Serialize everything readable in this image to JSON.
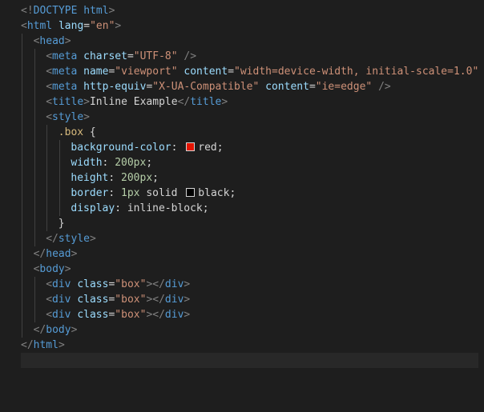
{
  "editor": {
    "lines": [
      {
        "tokens": [
          [
            "punct",
            "<!"
          ],
          [
            "tag",
            "DOCTYPE html"
          ],
          [
            "punct",
            ">"
          ]
        ]
      },
      {
        "tokens": [
          [
            "punct",
            "<"
          ],
          [
            "tag",
            "html"
          ],
          [
            "text",
            " "
          ],
          [
            "attr",
            "lang"
          ],
          [
            "text",
            "="
          ],
          [
            "str",
            "\"en\""
          ],
          [
            "punct",
            ">"
          ]
        ]
      },
      {
        "indent": 1,
        "tokens": [
          [
            "punct",
            "<"
          ],
          [
            "tag",
            "head"
          ],
          [
            "punct",
            ">"
          ]
        ]
      },
      {
        "indent": 2,
        "tokens": [
          [
            "punct",
            "<"
          ],
          [
            "tag",
            "meta"
          ],
          [
            "text",
            " "
          ],
          [
            "attr",
            "charset"
          ],
          [
            "text",
            "="
          ],
          [
            "str",
            "\"UTF-8\""
          ],
          [
            "text",
            " "
          ],
          [
            "punct",
            "/>"
          ]
        ]
      },
      {
        "indent": 2,
        "tokens": [
          [
            "punct",
            "<"
          ],
          [
            "tag",
            "meta"
          ],
          [
            "text",
            " "
          ],
          [
            "attr",
            "name"
          ],
          [
            "text",
            "="
          ],
          [
            "str",
            "\"viewport\""
          ],
          [
            "text",
            " "
          ],
          [
            "attr",
            "content"
          ],
          [
            "text",
            "="
          ],
          [
            "str",
            "\"width=device-width, initial-scale=1.0\""
          ],
          [
            "text",
            " "
          ]
        ],
        "overflow": true
      },
      {
        "indent": 2,
        "tokens": [
          [
            "punct",
            "<"
          ],
          [
            "tag",
            "meta"
          ],
          [
            "text",
            " "
          ],
          [
            "attr",
            "http-equiv"
          ],
          [
            "text",
            "="
          ],
          [
            "str",
            "\"X-UA-Compatible\""
          ],
          [
            "text",
            " "
          ],
          [
            "attr",
            "content"
          ],
          [
            "text",
            "="
          ],
          [
            "str",
            "\"ie=edge\""
          ],
          [
            "text",
            " "
          ],
          [
            "punct",
            "/>"
          ]
        ]
      },
      {
        "indent": 2,
        "tokens": [
          [
            "punct",
            "<"
          ],
          [
            "tag",
            "title"
          ],
          [
            "punct",
            ">"
          ],
          [
            "text",
            "Inline Example"
          ],
          [
            "punct",
            "</"
          ],
          [
            "tag",
            "title"
          ],
          [
            "punct",
            ">"
          ]
        ]
      },
      {
        "indent": 2,
        "tokens": [
          [
            "punct",
            "<"
          ],
          [
            "tag",
            "style"
          ],
          [
            "punct",
            ">"
          ]
        ]
      },
      {
        "indent": 3,
        "tokens": [
          [
            "sel",
            ".box"
          ],
          [
            "text",
            " {"
          ]
        ]
      },
      {
        "indent": 4,
        "tokens": [
          [
            "prop",
            "background-color"
          ],
          [
            "text",
            ": "
          ],
          [
            "swatch",
            "#e51400"
          ],
          [
            "val",
            "red"
          ],
          [
            "text",
            ";"
          ]
        ]
      },
      {
        "indent": 4,
        "tokens": [
          [
            "prop",
            "width"
          ],
          [
            "text",
            ": "
          ],
          [
            "num",
            "200px"
          ],
          [
            "text",
            ";"
          ]
        ]
      },
      {
        "indent": 4,
        "tokens": [
          [
            "prop",
            "height"
          ],
          [
            "text",
            ": "
          ],
          [
            "num",
            "200px"
          ],
          [
            "text",
            ";"
          ]
        ]
      },
      {
        "indent": 4,
        "tokens": [
          [
            "prop",
            "border"
          ],
          [
            "text",
            ": "
          ],
          [
            "num",
            "1px"
          ],
          [
            "val",
            " solid "
          ],
          [
            "swatch",
            "#000000"
          ],
          [
            "val",
            "black"
          ],
          [
            "text",
            ";"
          ]
        ]
      },
      {
        "indent": 4,
        "tokens": [
          [
            "prop",
            "display"
          ],
          [
            "text",
            ": "
          ],
          [
            "val",
            "inline-block"
          ],
          [
            "text",
            ";"
          ]
        ]
      },
      {
        "indent": 3,
        "tokens": [
          [
            "text",
            "}"
          ]
        ]
      },
      {
        "indent": 2,
        "tokens": [
          [
            "punct",
            "</"
          ],
          [
            "tag",
            "style"
          ],
          [
            "punct",
            ">"
          ]
        ]
      },
      {
        "indent": 1,
        "tokens": [
          [
            "punct",
            "</"
          ],
          [
            "tag",
            "head"
          ],
          [
            "punct",
            ">"
          ]
        ]
      },
      {
        "indent": 1,
        "tokens": [
          [
            "punct",
            "<"
          ],
          [
            "tag",
            "body"
          ],
          [
            "punct",
            ">"
          ]
        ]
      },
      {
        "indent": 2,
        "tokens": [
          [
            "punct",
            "<"
          ],
          [
            "tag",
            "div"
          ],
          [
            "text",
            " "
          ],
          [
            "attr",
            "class"
          ],
          [
            "text",
            "="
          ],
          [
            "str",
            "\"box\""
          ],
          [
            "punct",
            "></"
          ],
          [
            "tag",
            "div"
          ],
          [
            "punct",
            ">"
          ]
        ]
      },
      {
        "indent": 2,
        "tokens": [
          [
            "punct",
            "<"
          ],
          [
            "tag",
            "div"
          ],
          [
            "text",
            " "
          ],
          [
            "attr",
            "class"
          ],
          [
            "text",
            "="
          ],
          [
            "str",
            "\"box\""
          ],
          [
            "punct",
            "></"
          ],
          [
            "tag",
            "div"
          ],
          [
            "punct",
            ">"
          ]
        ]
      },
      {
        "indent": 2,
        "tokens": [
          [
            "punct",
            "<"
          ],
          [
            "tag",
            "div"
          ],
          [
            "text",
            " "
          ],
          [
            "attr",
            "class"
          ],
          [
            "text",
            "="
          ],
          [
            "str",
            "\"box\""
          ],
          [
            "punct",
            "></"
          ],
          [
            "tag",
            "div"
          ],
          [
            "punct",
            ">"
          ]
        ]
      },
      {
        "indent": 1,
        "tokens": [
          [
            "punct",
            "</"
          ],
          [
            "tag",
            "body"
          ],
          [
            "punct",
            ">"
          ]
        ]
      },
      {
        "tokens": [
          [
            "punct",
            "</"
          ],
          [
            "tag",
            "html"
          ],
          [
            "punct",
            ">"
          ]
        ]
      },
      {
        "tokens": [],
        "current": true
      }
    ],
    "colors": {
      "background": "#1e1e1e",
      "current_line": "#282828",
      "tag": "#569cd6",
      "attribute": "#9cdcfe",
      "string": "#ce9178",
      "selector": "#d7ba7d",
      "number": "#b5cea8"
    }
  }
}
